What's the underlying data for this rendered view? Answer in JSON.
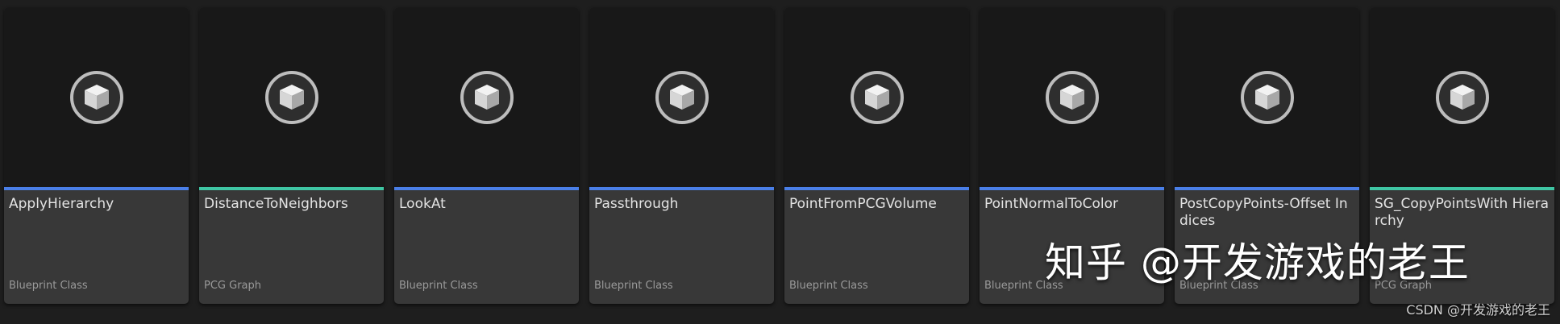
{
  "assets": [
    {
      "name": "ApplyHierarchy",
      "type": "Blueprint Class",
      "type_color": "#4a7fe8",
      "icon": "cube-icon"
    },
    {
      "name": "DistanceToNeighbors",
      "type": "PCG Graph",
      "type_color": "#3fc6a4",
      "icon": "cube-icon"
    },
    {
      "name": "LookAt",
      "type": "Blueprint Class",
      "type_color": "#4a7fe8",
      "icon": "cube-icon"
    },
    {
      "name": "Passthrough",
      "type": "Blueprint Class",
      "type_color": "#4a7fe8",
      "icon": "cube-icon"
    },
    {
      "name": "PointFromPCGVolume",
      "type": "Blueprint Class",
      "type_color": "#4a7fe8",
      "icon": "cube-icon"
    },
    {
      "name": "PointNormalToColor",
      "type": "Blueprint Class",
      "type_color": "#4a7fe8",
      "icon": "cube-icon"
    },
    {
      "name": "PostCopyPoints-Offset Indices",
      "type": "Blueprint Class",
      "type_color": "#4a7fe8",
      "icon": "cube-icon"
    },
    {
      "name": "SG_CopyPointsWith Hierarchy",
      "type": "PCG Graph",
      "type_color": "#3fc6a4",
      "icon": "cube-icon"
    }
  ],
  "watermark": "知乎 @开发游戏的老王",
  "csdn_watermark": "CSDN @开发游戏的老王"
}
